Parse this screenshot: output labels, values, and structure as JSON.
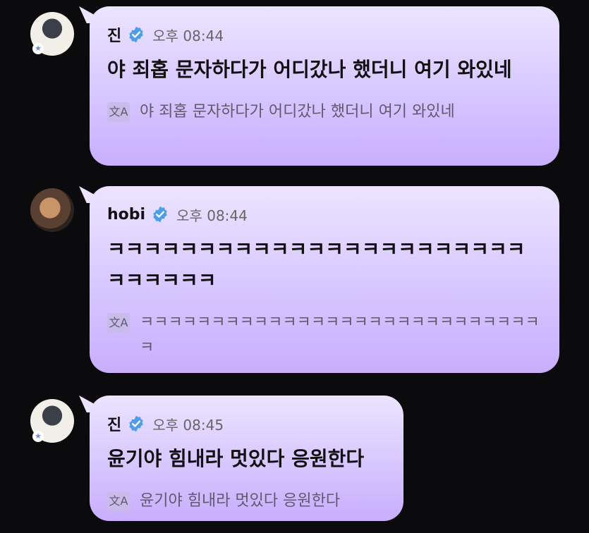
{
  "messages": [
    {
      "sender": "진",
      "time": "오후 08:44",
      "text": "야 죄홉 문자하다가 어디갔나 했더니 여기 와있네",
      "translation": "야 죄홉 문자하다가 어디갔나 했더니 여기 와있네",
      "avatar_icon": "jin-avatar"
    },
    {
      "sender": "hobi",
      "time": "오후 08:44",
      "text": "ㅋㅋㅋㅋㅋㅋㅋㅋㅋㅋㅋㅋㅋㅋㅋㅋㅋㅋㅋㅋㅋㅋㅋㅋㅋㅋㅋㅋㅋ",
      "translation": "ㅋㅋㅋㅋㅋㅋㅋㅋㅋㅋㅋㅋㅋㅋㅋㅋㅋㅋㅋㅋㅋㅋㅋㅋㅋㅋㅋㅋㅋ",
      "avatar_icon": "hobi-avatar"
    },
    {
      "sender": "진",
      "time": "오후 08:45",
      "text": "윤기야 힘내라 멋있다 응원한다",
      "translation": "윤기야 힘내라 멋있다 응원한다",
      "avatar_icon": "jin-avatar"
    }
  ],
  "icons": {
    "verified": "verified-check-icon",
    "translate": "translate-icon",
    "avatar_badge": "star-icon"
  },
  "colors": {
    "background": "#0b0b0d",
    "bubble_top": "#ece4ff",
    "bubble_bottom": "#c8aefd",
    "verified_blue": "#4c9ee8"
  }
}
